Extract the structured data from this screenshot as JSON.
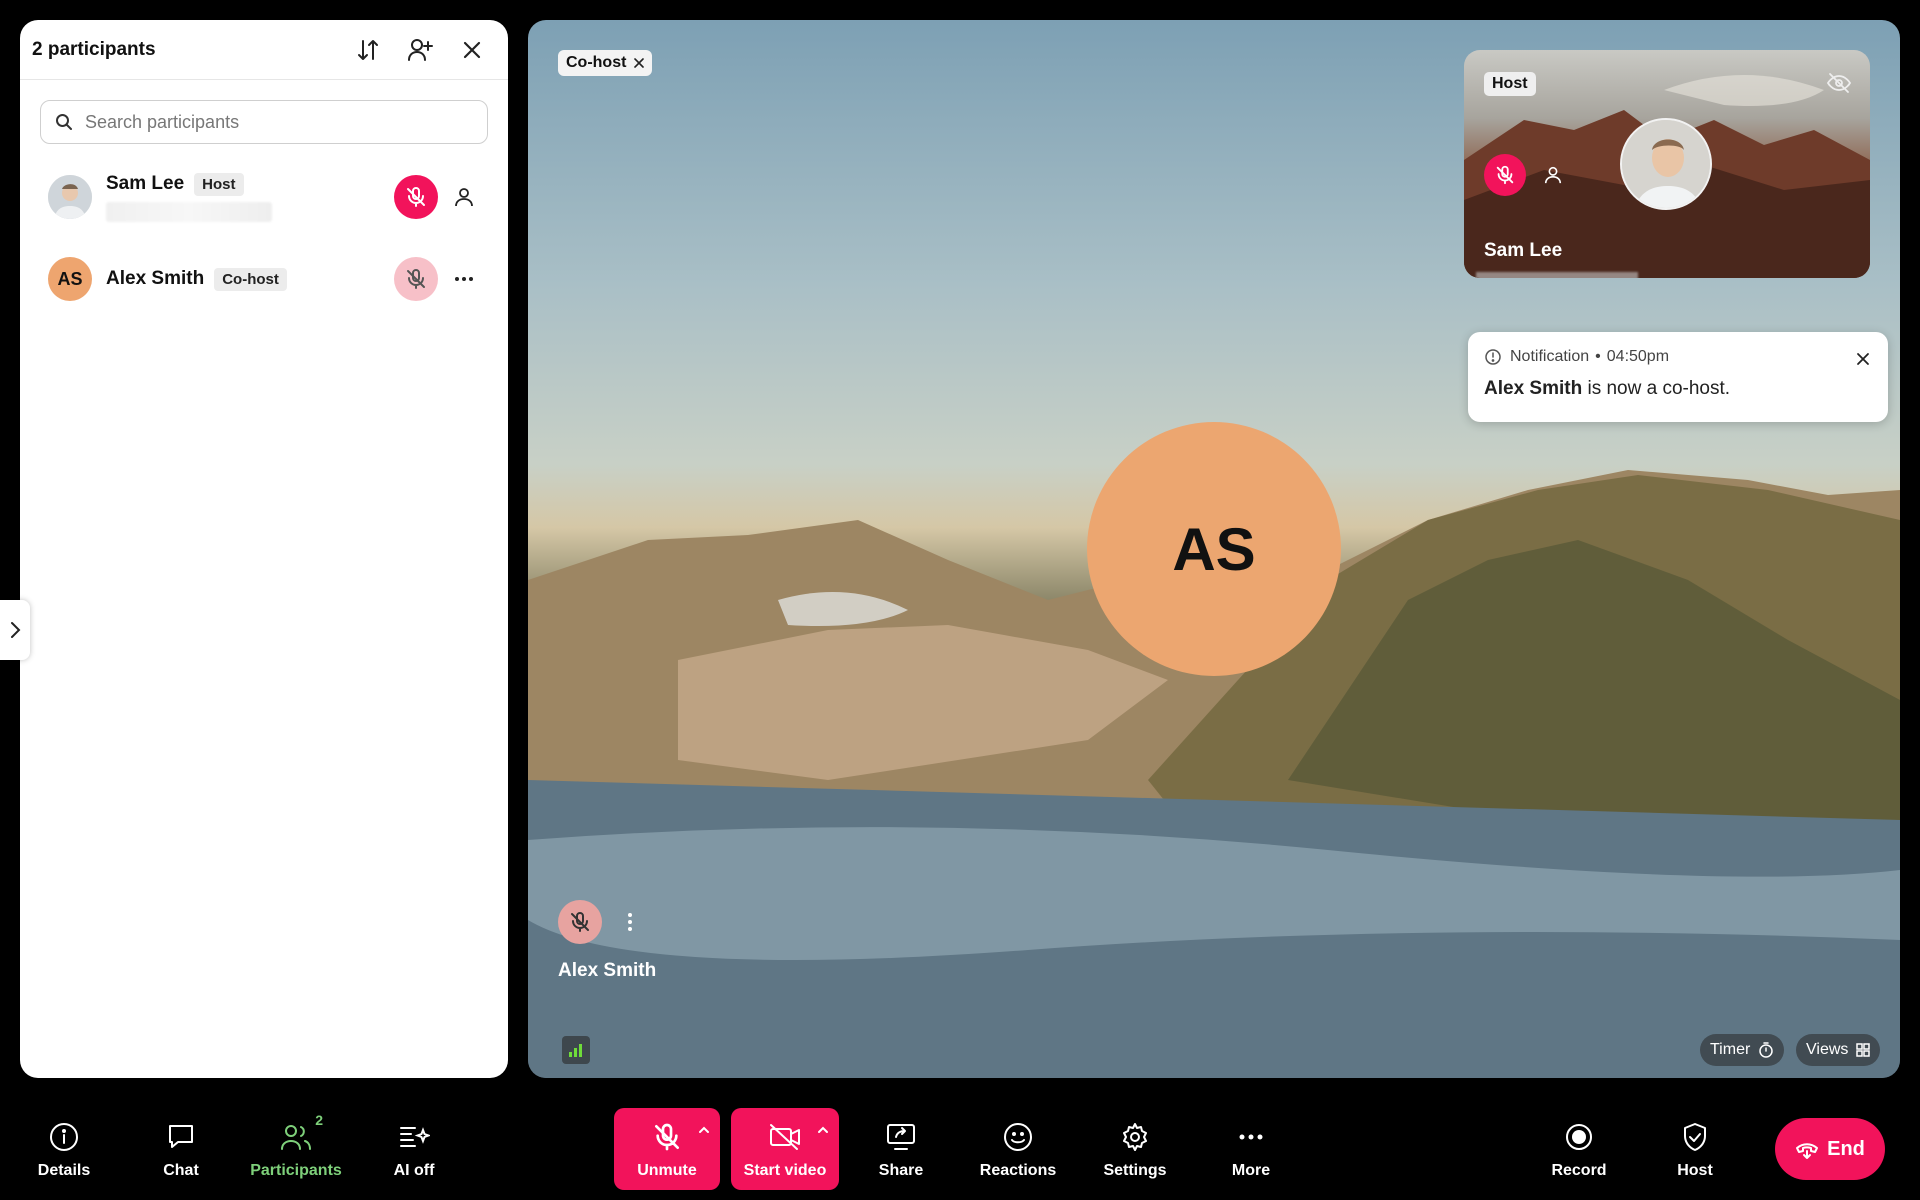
{
  "panel": {
    "title": "2 participants",
    "search_placeholder": "Search participants",
    "participants": [
      {
        "name": "Sam Lee",
        "role": "Host"
      },
      {
        "name": "Alex Smith",
        "role": "Co-host",
        "initials": "AS"
      }
    ]
  },
  "stage": {
    "cohost_chip": "Co-host",
    "speaker_initials": "AS",
    "speaker_name": "Alex Smith",
    "self_tile": {
      "badge": "Host",
      "name": "Sam Lee"
    },
    "notification": {
      "label": "Notification",
      "separator": "•",
      "time": "04:50pm",
      "actor": "Alex Smith",
      "message": " is now a co-host."
    },
    "timer_label": "Timer",
    "views_label": "Views"
  },
  "toolbar": {
    "details": "Details",
    "chat": "Chat",
    "participants": "Participants",
    "participants_count": "2",
    "ai": "AI off",
    "unmute": "Unmute",
    "start_video": "Start video",
    "share": "Share",
    "reactions": "Reactions",
    "settings": "Settings",
    "more": "More",
    "record": "Record",
    "host": "Host",
    "end": "End"
  },
  "colors": {
    "accent_red": "#f2135b",
    "active_green": "#7ed07a",
    "avatar_orange": "#eca670"
  }
}
